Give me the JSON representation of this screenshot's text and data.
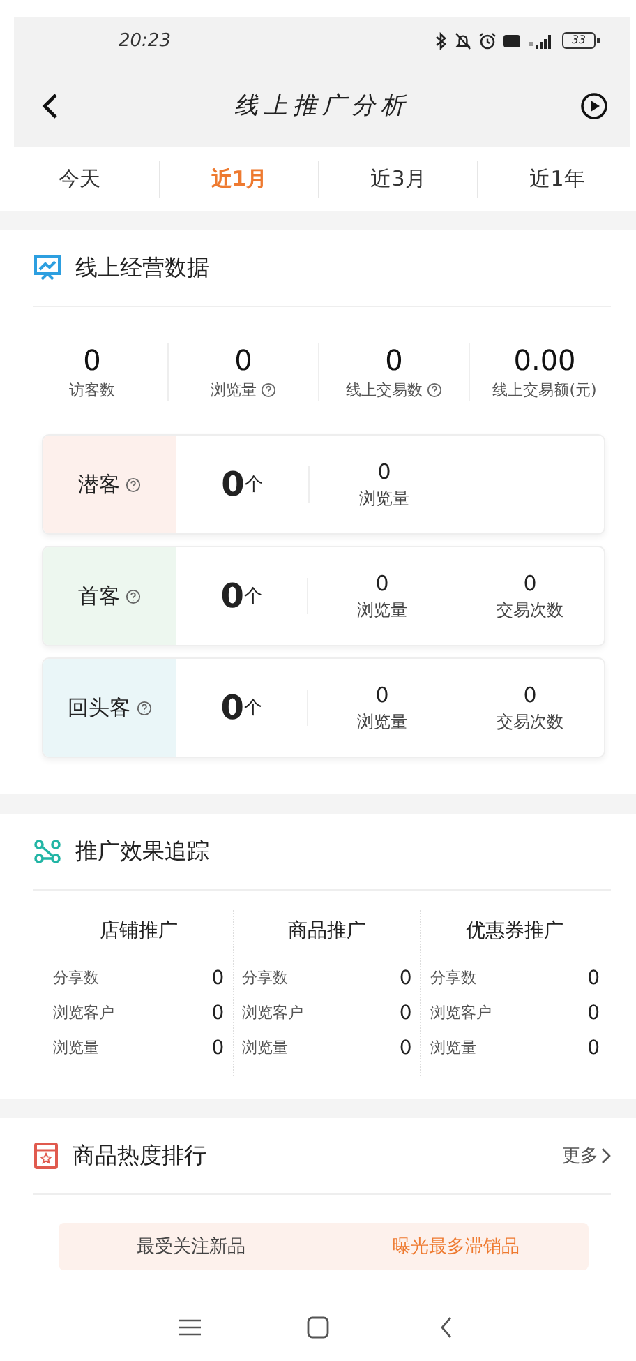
{
  "status_bar": {
    "time": "20:23",
    "battery": "33"
  },
  "header": {
    "title": "线上推广分析"
  },
  "tabs": [
    {
      "label": "今天",
      "selected": false
    },
    {
      "label": "近1月",
      "selected": true
    },
    {
      "label": "近3月",
      "selected": false
    },
    {
      "label": "近1年",
      "selected": false
    }
  ],
  "business_section": {
    "title": "线上经营数据",
    "stats": [
      {
        "value": "0",
        "label": "访客数",
        "help": false
      },
      {
        "value": "0",
        "label": "浏览量",
        "help": true
      },
      {
        "value": "0",
        "label": "线上交易数",
        "help": true
      },
      {
        "value": "0.00",
        "label": "线上交易额(元)",
        "help": false
      }
    ],
    "customers": [
      {
        "name": "潜客",
        "color": "#fdf0ec",
        "count": "0",
        "unit": "个",
        "metrics": [
          {
            "value": "0",
            "label": "浏览量"
          }
        ]
      },
      {
        "name": "首客",
        "color": "#edf7ef",
        "count": "0",
        "unit": "个",
        "metrics": [
          {
            "value": "0",
            "label": "浏览量"
          },
          {
            "value": "0",
            "label": "交易次数"
          }
        ]
      },
      {
        "name": "回头客",
        "color": "#eaf6f8",
        "count": "0",
        "unit": "个",
        "metrics": [
          {
            "value": "0",
            "label": "浏览量"
          },
          {
            "value": "0",
            "label": "交易次数"
          }
        ]
      }
    ]
  },
  "tracking_section": {
    "title": "推广效果追踪",
    "columns": [
      {
        "title": "店铺推广",
        "rows": [
          {
            "label": "分享数",
            "value": "0"
          },
          {
            "label": "浏览客户",
            "value": "0"
          },
          {
            "label": "浏览量",
            "value": "0"
          }
        ]
      },
      {
        "title": "商品推广",
        "rows": [
          {
            "label": "分享数",
            "value": "0"
          },
          {
            "label": "浏览客户",
            "value": "0"
          },
          {
            "label": "浏览量",
            "value": "0"
          }
        ]
      },
      {
        "title": "优惠券推广",
        "rows": [
          {
            "label": "分享数",
            "value": "0"
          },
          {
            "label": "浏览客户",
            "value": "0"
          },
          {
            "label": "浏览量",
            "value": "0"
          }
        ]
      }
    ]
  },
  "ranking_section": {
    "title": "商品热度排行",
    "more": "更多",
    "tabs": [
      {
        "label": "最受关注新品",
        "selected": false
      },
      {
        "label": "曝光最多滞销品",
        "selected": true
      }
    ]
  }
}
